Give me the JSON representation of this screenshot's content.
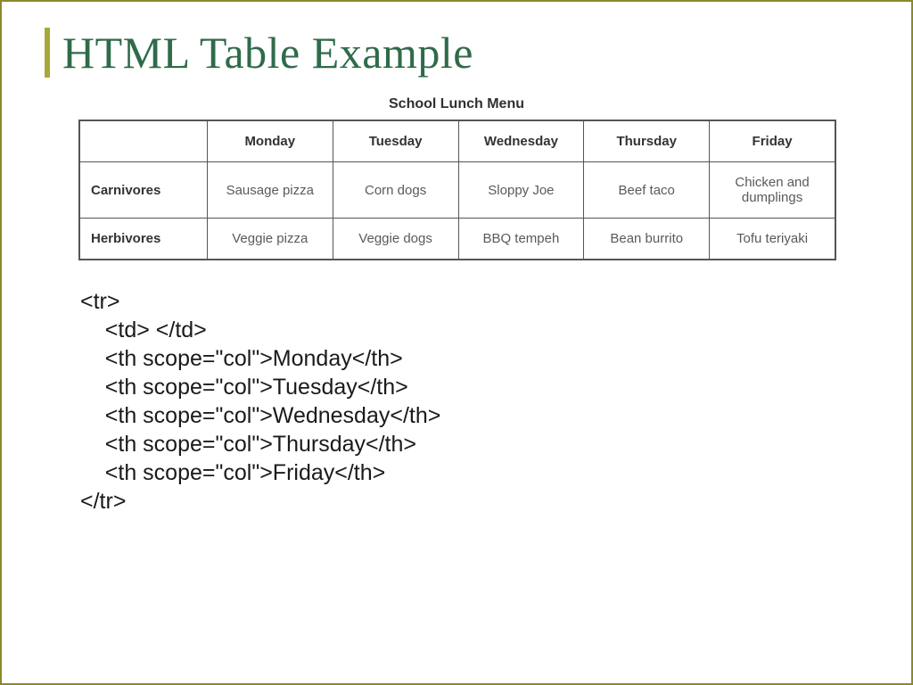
{
  "slide": {
    "title": "HTML Table Example",
    "table": {
      "caption": "School Lunch Menu",
      "columns": [
        "",
        "Monday",
        "Tuesday",
        "Wednesday",
        "Thursday",
        "Friday"
      ],
      "rows": [
        {
          "head": "Carnivores",
          "cells": [
            "Sausage pizza",
            "Corn dogs",
            "Sloppy Joe",
            "Beef taco",
            "Chicken and dumplings"
          ]
        },
        {
          "head": "Herbivores",
          "cells": [
            "Veggie pizza",
            "Veggie dogs",
            "BBQ tempeh",
            "Bean burrito",
            "Tofu teriyaki"
          ]
        }
      ]
    },
    "code": {
      "l0": "<tr>",
      "l1": "    <td> </td>",
      "l2": "    <th scope=\"col\">Monday</th>",
      "l3": "    <th scope=\"col\">Tuesday</th>",
      "l4": "    <th scope=\"col\">Wednesday</th>",
      "l5": "    <th scope=\"col\">Thursday</th>",
      "l6": "    <th scope=\"col\">Friday</th>",
      "l7": "</tr>"
    }
  }
}
